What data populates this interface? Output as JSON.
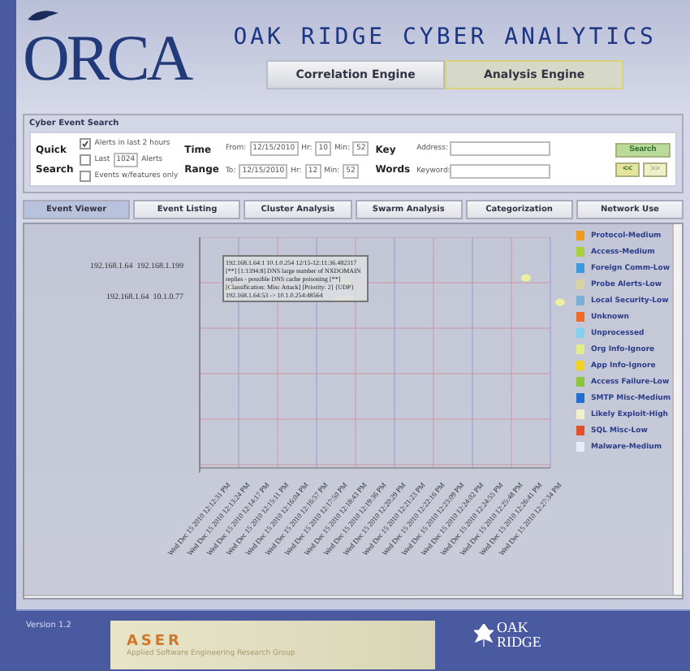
{
  "header": {
    "logo": "ORCA",
    "title": "OAK RIDGE CYBER ANALYTICS"
  },
  "engine_tabs": [
    {
      "label": "Correlation Engine",
      "selected": false
    },
    {
      "label": "Analysis Engine",
      "selected": true
    }
  ],
  "search": {
    "title": "Cyber Event Search",
    "quick_label": [
      "Quick",
      "Search"
    ],
    "quick_options": [
      {
        "kind": "check",
        "label": "Alerts in last 2 hours",
        "checked": true
      },
      {
        "kind": "count",
        "before": "Last",
        "value": "1024",
        "after": "Alerts",
        "checked": false
      },
      {
        "kind": "check",
        "label": "Events w/features only",
        "checked": false
      }
    ],
    "time_label": [
      "Time",
      "Range"
    ],
    "time_rows": [
      {
        "label": "From:",
        "date": "12/15/2010",
        "hr_label": "Hr:",
        "hr": "10",
        "min_label": "Min:",
        "min": "52"
      },
      {
        "label": "To:",
        "date": "12/15/2010",
        "hr_label": "Hr:",
        "hr": "12",
        "min_label": "Min:",
        "min": "52"
      }
    ],
    "key_label": [
      "Key",
      "Words"
    ],
    "key_fields": [
      {
        "label": "Address:"
      },
      {
        "label": "Keyword:"
      }
    ],
    "search_button": "Search",
    "prev_button": "<<",
    "next_button": ">>"
  },
  "view_tabs": [
    {
      "label": "Event Viewer",
      "selected": true
    },
    {
      "label": "Event Listing",
      "selected": false
    },
    {
      "label": "Cluster Analysis",
      "selected": false
    },
    {
      "label": "Swarm Analysis",
      "selected": false
    },
    {
      "label": "Categorization",
      "selected": false
    },
    {
      "label": "Network Use",
      "selected": false
    }
  ],
  "event_viewer": {
    "y_labels": [
      "192.168.1.64  192.168.1.199",
      "192.168.1.64  10.1.0.77"
    ],
    "tooltip": "192.168.1.64:1 10.1.0.254 12/15-12:11:36.482317 [**] [1:1394:8] DNS large number of NXDOMAIN replies - possible DNS cache poisoning [**] [Classification: Misc Attack] [Priority: 2] {UDP} 192.168.1.64:53 -> 10.1.0.254:48564",
    "x_labels": [
      "Wed Dec 15 2010 12:12:31 PM",
      "Wed Dec 15 2010 12:13:24 PM",
      "Wed Dec 15 2010 12:14:17 PM",
      "Wed Dec 15 2010 12:15:11 PM",
      "Wed Dec 15 2010 12:16:04 PM",
      "Wed Dec 15 2010 12:16:57 PM",
      "Wed Dec 15 2010 12:17:50 PM",
      "Wed Dec 15 2010 12:18:43 PM",
      "Wed Dec 15 2010 12:19:36 PM",
      "Wed Dec 15 2010 12:20:29 PM",
      "Wed Dec 15 2010 12:21:23 PM",
      "Wed Dec 15 2010 12:22:16 PM",
      "Wed Dec 15 2010 12:23:09 PM",
      "Wed Dec 15 2010 12:24:02 PM",
      "Wed Dec 15 2010 12:24:55 PM",
      "Wed Dec 15 2010 12:25:48 PM",
      "Wed Dec 15 2010 12:26:41 PM",
      "Wed Dec 15 2010 12:27:34 PM"
    ],
    "legend": [
      {
        "label": "Protocol-Medium",
        "color": "#f39a1e"
      },
      {
        "label": "Access-Medium",
        "color": "#a9d13a"
      },
      {
        "label": "Foreign Comm-Low",
        "color": "#3a9be0"
      },
      {
        "label": "Probe Alerts-Low",
        "color": "#d8d3a0"
      },
      {
        "label": "Local Security-Low",
        "color": "#7aafd6"
      },
      {
        "label": "Unknown",
        "color": "#f06a2a"
      },
      {
        "label": "Unprocessed",
        "color": "#7fd3ef"
      },
      {
        "label": "Org Info-Ignore",
        "color": "#e2ec8a"
      },
      {
        "label": "App Info-Ignore",
        "color": "#f2d21a"
      },
      {
        "label": "Access Failure-Low",
        "color": "#8cc63a"
      },
      {
        "label": "SMTP Misc-Medium",
        "color": "#1f6fd0"
      },
      {
        "label": "Likely Exploit-High",
        "color": "#f3efc8"
      },
      {
        "label": "SQL Misc-Low",
        "color": "#e0502a"
      },
      {
        "label": "Malware-Medium",
        "color": "#e8eef5"
      }
    ]
  },
  "footer": {
    "version": "Version 1.2",
    "banner_title": "ASER",
    "banner_subtitle": "Applied Software Engineering Research Group",
    "org_logo": [
      "OAK",
      "RIDGE"
    ]
  }
}
